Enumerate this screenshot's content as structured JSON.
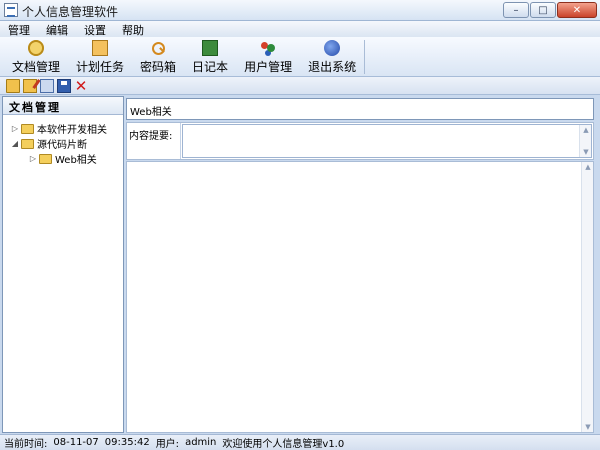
{
  "window": {
    "title": "个人信息管理软件",
    "minimize": "–",
    "maximize": "□",
    "close": "✕"
  },
  "menu": [
    "管理",
    "编辑",
    "设置",
    "帮助"
  ],
  "toolbar": [
    {
      "label": "文档管理",
      "icon": "document-manage-icon"
    },
    {
      "label": "计划任务",
      "icon": "plan-task-icon"
    },
    {
      "label": "密码箱",
      "icon": "key-icon"
    },
    {
      "label": "日记本",
      "icon": "notebook-icon"
    },
    {
      "label": "用户管理",
      "icon": "users-icon"
    },
    {
      "label": "退出系统",
      "icon": "exit-icon"
    }
  ],
  "subtoolbar": {
    "delete": "✕"
  },
  "left_panel": {
    "header": "文档管理",
    "tree": [
      {
        "label": "本软件开发相关",
        "expander": "▷"
      },
      {
        "label": "源代码片断",
        "expander": "◢"
      },
      {
        "label": "Web相关",
        "expander": "▷"
      }
    ]
  },
  "editor": {
    "title_value": "Web相关",
    "summary_label": "内容提要:",
    "summary_value": "",
    "content_value": "",
    "scroll_up": "▲",
    "scroll_down": "▼"
  },
  "status": {
    "time_label": "当前时间:",
    "date": "08-11-07",
    "time": "09:35:42",
    "user_label": "用户:",
    "user": "admin",
    "welcome": "欢迎使用个人信息管理v1.0"
  }
}
